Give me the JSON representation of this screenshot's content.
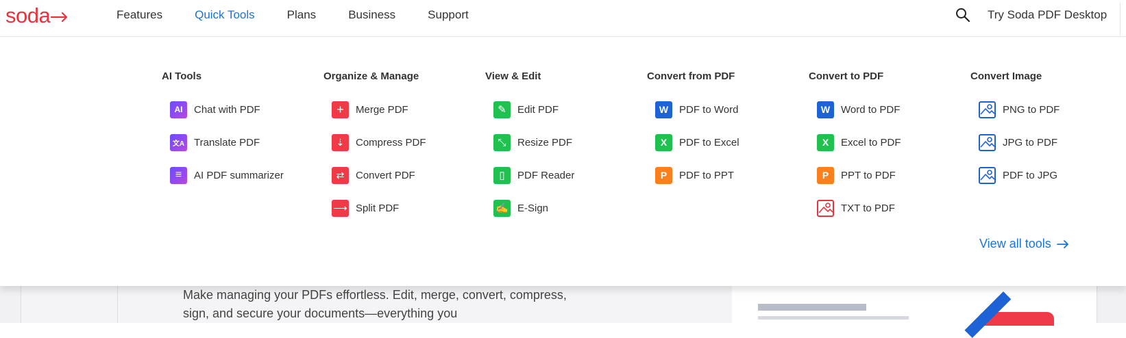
{
  "header": {
    "logo_text": "soda",
    "nav": [
      {
        "label": "Features",
        "active": false
      },
      {
        "label": "Quick Tools",
        "active": true
      },
      {
        "label": "Plans",
        "active": false
      },
      {
        "label": "Business",
        "active": false
      },
      {
        "label": "Support",
        "active": false
      }
    ],
    "search_icon": "search-icon",
    "try_link": "Try Soda PDF Desktop"
  },
  "menu": {
    "columns": [
      {
        "title": "AI Tools",
        "items": [
          {
            "label": "Chat with PDF",
            "icon": "ai-chat-icon",
            "glyph": "AI"
          },
          {
            "label": "Translate PDF",
            "icon": "translate-icon",
            "glyph": "文A"
          },
          {
            "label": "AI PDF summarizer",
            "icon": "summarize-icon",
            "glyph": "≡"
          }
        ]
      },
      {
        "title": "Organize & Manage",
        "items": [
          {
            "label": "Merge PDF",
            "icon": "merge-icon",
            "glyph": "+"
          },
          {
            "label": "Compress PDF",
            "icon": "compress-icon",
            "glyph": "⇣"
          },
          {
            "label": "Convert PDF",
            "icon": "convert-icon",
            "glyph": "⇄"
          },
          {
            "label": "Split PDF",
            "icon": "split-icon",
            "glyph": "⟶"
          }
        ]
      },
      {
        "title": "View & Edit",
        "items": [
          {
            "label": "Edit PDF",
            "icon": "pencil-icon",
            "glyph": "✎"
          },
          {
            "label": "Resize PDF",
            "icon": "resize-icon",
            "glyph": "⤡"
          },
          {
            "label": "PDF Reader",
            "icon": "book-icon",
            "glyph": "▯"
          },
          {
            "label": "E-Sign",
            "icon": "signature-icon",
            "glyph": "✍"
          }
        ]
      },
      {
        "title": "Convert from PDF",
        "items": [
          {
            "label": "PDF to Word",
            "icon": "word-icon",
            "glyph": "W"
          },
          {
            "label": "PDF to Excel",
            "icon": "excel-icon",
            "glyph": "X"
          },
          {
            "label": "PDF to PPT",
            "icon": "powerpoint-icon",
            "glyph": "P"
          }
        ]
      },
      {
        "title": "Convert to PDF",
        "items": [
          {
            "label": "Word to PDF",
            "icon": "word-icon",
            "glyph": "W"
          },
          {
            "label": "Excel to PDF",
            "icon": "excel-icon",
            "glyph": "X"
          },
          {
            "label": "PPT to PDF",
            "icon": "powerpoint-icon",
            "glyph": "P"
          },
          {
            "label": "TXT to PDF",
            "icon": "text-image-icon",
            "glyph": ""
          }
        ]
      },
      {
        "title": "Convert Image",
        "items": [
          {
            "label": "PNG to PDF",
            "icon": "image-icon",
            "glyph": ""
          },
          {
            "label": "JPG to PDF",
            "icon": "image-icon",
            "glyph": ""
          },
          {
            "label": "PDF to JPG",
            "icon": "image-icon",
            "glyph": ""
          }
        ]
      }
    ],
    "view_all": "View all tools"
  },
  "hero": {
    "text": "Make managing your PDFs effortless. Edit, merge, convert, compress, sign, and secure your documents—everything you"
  },
  "colors": {
    "brand_red": "#e8333e",
    "link_blue": "#1a73d9",
    "ai_purple": "#7b4ce8",
    "tool_red": "#ef3a47",
    "tool_green": "#21c150",
    "word_blue": "#1d63d6",
    "ppt_orange": "#f9801c"
  }
}
